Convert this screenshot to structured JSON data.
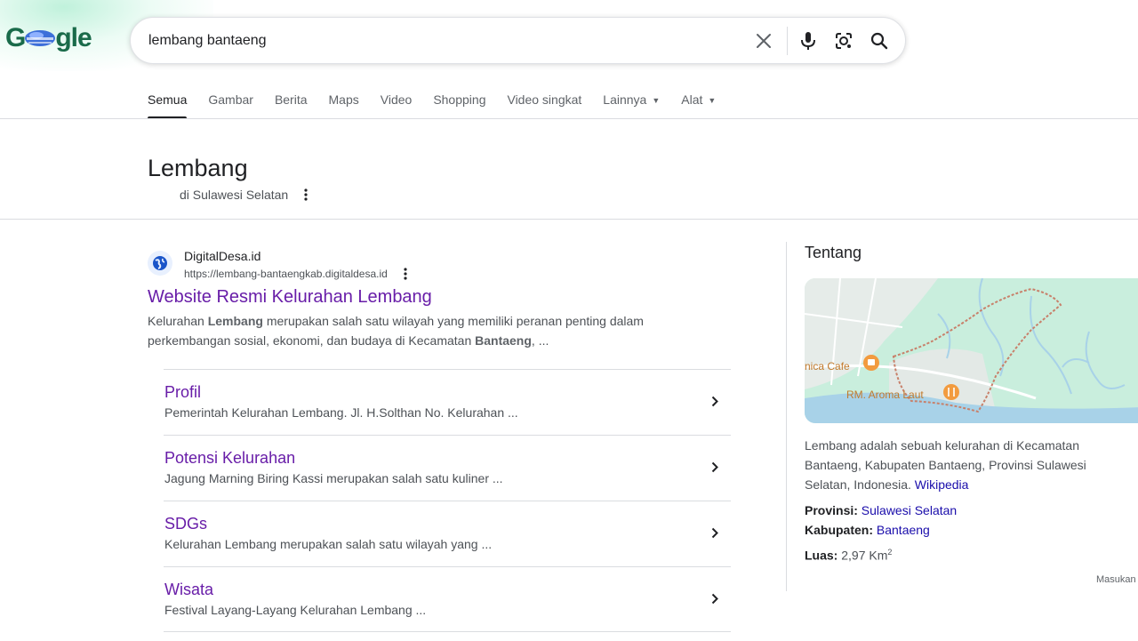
{
  "logo": {
    "text_pre": "G",
    "text_post": "gle"
  },
  "search": {
    "query": "lembang bantaeng"
  },
  "tabs": [
    {
      "label": "Semua",
      "active": true
    },
    {
      "label": "Gambar"
    },
    {
      "label": "Berita"
    },
    {
      "label": "Maps"
    },
    {
      "label": "Video"
    },
    {
      "label": "Shopping"
    },
    {
      "label": "Video singkat"
    },
    {
      "label": "Lainnya",
      "dropdown": true
    },
    {
      "label": "Alat",
      "dropdown": true
    }
  ],
  "entity": {
    "title": "Lembang",
    "subtitle": "di Sulawesi Selatan"
  },
  "result": {
    "site_name": "DigitalDesa.id",
    "url": "https://lembang-bantaengkab.digitaldesa.id",
    "title": "Website Resmi Kelurahan Lembang",
    "snippet": {
      "p1": "Kelurahan ",
      "b1": "Lembang",
      "p2": " merupakan salah satu wilayah yang memiliki peranan penting dalam perkembangan sosial, ekonomi, dan budaya di Kecamatan ",
      "b2": "Bantaeng",
      "p3": ", ..."
    },
    "sitelinks": [
      {
        "title": "Profil",
        "desc": "Pemerintah Kelurahan Lembang. Jl. H.Solthan No. Kelurahan ..."
      },
      {
        "title": "Potensi Kelurahan",
        "desc": "Jagung Marning Biring Kassi merupakan salah satu kuliner ..."
      },
      {
        "title": "SDGs",
        "desc": "Kelurahan Lembang merupakan salah satu wilayah yang ..."
      },
      {
        "title": "Wisata",
        "desc": "Festival Layang-Layang Kelurahan Lembang ..."
      }
    ]
  },
  "knowledge_panel": {
    "heading": "Tentang",
    "map": {
      "label_cafe": "nica Cafe",
      "label_restaurant": "RM. Aroma Laut"
    },
    "description": "Lembang adalah sebuah kelurahan di Kecamatan Bantaeng, Kabupaten Bantaeng, Provinsi Sulawesi Selatan, Indonesia. ",
    "source_link": "Wikipedia",
    "facts": [
      {
        "key": "Provinsi:",
        "value": "Sulawesi Selatan",
        "link": true
      },
      {
        "key": "Kabupaten:",
        "value": "Bantaeng",
        "link": true
      },
      {
        "key": "Luas:",
        "value": "2,97 Km",
        "sup": "2",
        "link": false
      }
    ],
    "feedback": "Masukan"
  },
  "colors": {
    "visited_link": "#681da8",
    "link": "#1a0dab",
    "text": "#202124",
    "secondary": "#4d5156"
  }
}
